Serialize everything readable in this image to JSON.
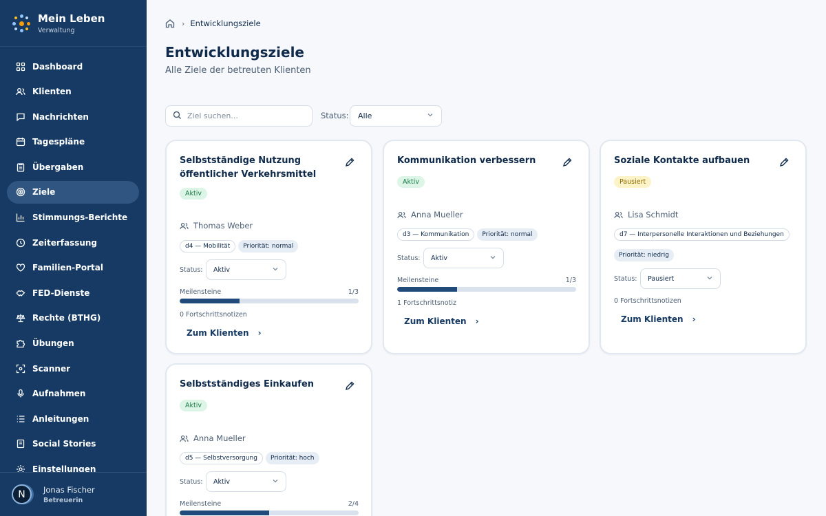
{
  "app": {
    "title": "Mein Leben",
    "subtitle": "Verwaltung"
  },
  "sidebar": {
    "items": [
      {
        "label": "Dashboard",
        "icon": "dashboard-icon"
      },
      {
        "label": "Klienten",
        "icon": "users-icon"
      },
      {
        "label": "Nachrichten",
        "icon": "message-icon"
      },
      {
        "label": "Tagespläne",
        "icon": "calendar-icon"
      },
      {
        "label": "Übergaben",
        "icon": "clipboard-icon"
      },
      {
        "label": "Ziele",
        "icon": "target-icon",
        "active": true
      },
      {
        "label": "Stimmungs-Berichte",
        "icon": "chart-icon"
      },
      {
        "label": "Zeiterfassung",
        "icon": "clock-icon"
      },
      {
        "label": "Familien-Portal",
        "icon": "heart-icon"
      },
      {
        "label": "FED-Dienste",
        "icon": "handshake-icon"
      },
      {
        "label": "Rechte (BTHG)",
        "icon": "scale-icon"
      },
      {
        "label": "Übungen",
        "icon": "puzzle-icon"
      },
      {
        "label": "Scanner",
        "icon": "scan-icon"
      },
      {
        "label": "Aufnahmen",
        "icon": "microphone-icon"
      },
      {
        "label": "Anleitungen",
        "icon": "list-icon"
      },
      {
        "label": "Social Stories",
        "icon": "book-icon"
      },
      {
        "label": "Einstellungen",
        "icon": "settings-icon"
      }
    ]
  },
  "user": {
    "initial": "N",
    "name": "Jonas Fischer",
    "role": "Betreuerin"
  },
  "breadcrumb": {
    "current": "Entwicklungsziele"
  },
  "header": {
    "title": "Entwicklungsziele",
    "subtitle": "Alle Ziele der betreuten Klienten"
  },
  "filters": {
    "search_placeholder": "Ziel suchen...",
    "status_label": "Status:",
    "status_value": "Alle"
  },
  "cards": [
    {
      "title": "Selbstständige Nutzung öffentlicher Verkehrsmittel",
      "badge": "Aktiv",
      "client": "Thomas Weber",
      "tag_domain": "d4 — Mobilität",
      "tag_priority": "Priorität: normal",
      "status_label": "Status:",
      "status_value": "Aktiv",
      "milestones_label": "Meilensteine",
      "milestones_value": "1/3",
      "progress": 0.333,
      "notes": "0 Fortschrittsnotizen",
      "link": "Zum Klienten"
    },
    {
      "title": "Kommunikation verbessern",
      "badge": "Aktiv",
      "client": "Anna Mueller",
      "tag_domain": "d3 — Kommunikation",
      "tag_priority": "Priorität: normal",
      "status_label": "Status:",
      "status_value": "Aktiv",
      "milestones_label": "Meilensteine",
      "milestones_value": "1/3",
      "progress": 0.333,
      "notes": "1 Fortschrittsnotiz",
      "link": "Zum Klienten"
    },
    {
      "title": "Soziale Kontakte aufbauen",
      "badge": "Pausiert",
      "client": "Lisa Schmidt",
      "tag_domain": "d7 — Interpersonelle Interaktionen und Beziehungen",
      "tag_priority": "Priorität: niedrig",
      "status_label": "Status:",
      "status_value": "Pausiert",
      "notes": "0 Fortschrittsnotizen",
      "link": "Zum Klienten"
    },
    {
      "title": "Selbstständiges Einkaufen",
      "badge": "Aktiv",
      "client": "Anna Mueller",
      "tag_domain": "d5 — Selbstversorgung",
      "tag_priority": "Priorität: hoch",
      "status_label": "Status:",
      "status_value": "Aktiv",
      "milestones_label": "Meilensteine",
      "milestones_value": "2/4",
      "progress": 0.5
    }
  ],
  "colors": {
    "sidebar": "#163a63",
    "accent": "#1f4a7a",
    "active_badge": "#dcf5e6",
    "paused_badge": "#fdf3c8"
  }
}
